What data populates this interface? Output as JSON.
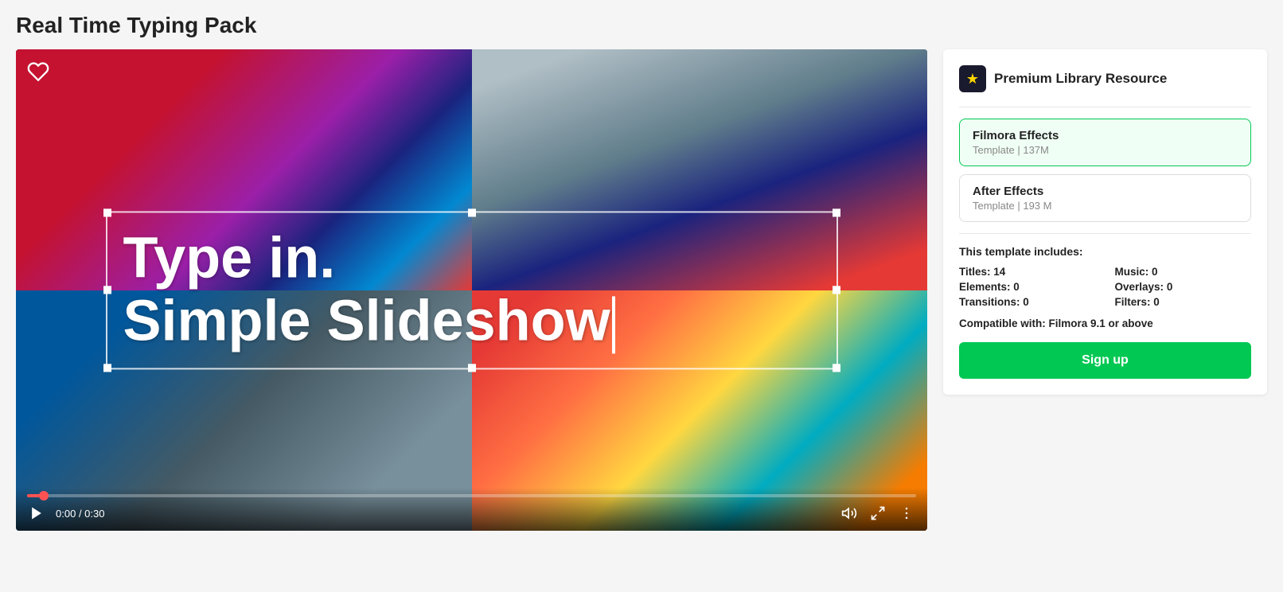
{
  "page": {
    "title": "Real Time Typing Pack"
  },
  "video": {
    "time_current": "0:00",
    "time_total": "0:30",
    "typing_line1": "Type in.",
    "typing_line2": "Simple Slideshow",
    "heart_label": "favorite"
  },
  "sidebar": {
    "premium_label": "Premium Library Resource",
    "filmora_option": {
      "title": "Filmora Effects",
      "subtitle": "Template | 137M"
    },
    "after_effects_option": {
      "title": "After Effects",
      "subtitle": "Template | 193 M"
    },
    "includes": {
      "heading": "This template includes:",
      "titles_label": "Titles:",
      "titles_value": "14",
      "music_label": "Music:",
      "music_value": "0",
      "elements_label": "Elements:",
      "elements_value": "0",
      "overlays_label": "Overlays:",
      "overlays_value": "0",
      "transitions_label": "Transitions:",
      "transitions_value": "0",
      "filters_label": "Filters:",
      "filters_value": "0",
      "compatible_prefix": "Compatible with:",
      "compatible_value": "Filmora 9.1 or above"
    },
    "signup_label": "Sign up"
  }
}
